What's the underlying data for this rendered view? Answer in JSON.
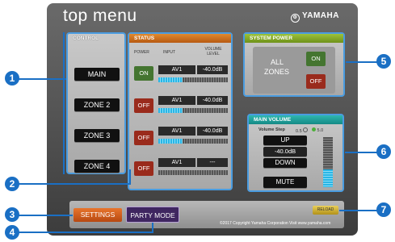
{
  "header": {
    "title": "top menu",
    "brand": "YAMAHA"
  },
  "control": {
    "heading": "CONTROL",
    "zones": [
      "MAIN",
      "ZONE 2",
      "ZONE 3",
      "ZONE 4"
    ]
  },
  "status": {
    "heading": "STATUS",
    "col_power": "POWER",
    "col_input": "INPUT",
    "col_volume": "VOLUME LEVEL",
    "rows": [
      {
        "power": "ON",
        "input": "AV1",
        "volume": "-40.0dB",
        "level": 0.35
      },
      {
        "power": "OFF",
        "input": "AV1",
        "volume": "-40.0dB",
        "level": 0.35
      },
      {
        "power": "OFF",
        "input": "AV1",
        "volume": "-40.0dB",
        "level": 0.35
      },
      {
        "power": "OFF",
        "input": "AV1",
        "volume": "---",
        "level": 0
      }
    ]
  },
  "system_power": {
    "heading": "SYSTEM POWER",
    "label_line1": "ALL",
    "label_line2": "ZONES",
    "on": "ON",
    "off": "OFF"
  },
  "main_volume": {
    "heading": "MAIN VOLUME",
    "step_label": "Volume Step",
    "step_opt1": "0.5",
    "step_opt2": "5.0",
    "up": "UP",
    "value": "-40.0dB",
    "down": "DOWN",
    "mute": "MUTE",
    "level": 0.35
  },
  "footer": {
    "settings": "SETTINGS",
    "party_mode": "PARTY MODE",
    "reload": "RELOAD",
    "copyright": "©2017 Copyright Yamaha Corporation Visit  www.yamaha.com"
  },
  "callouts": [
    "1",
    "2",
    "3",
    "4",
    "5",
    "6",
    "7"
  ],
  "colors": {
    "accent_blue": "#1a6fc4",
    "on_green": "#447530",
    "off_red": "#9a2b1c",
    "settings_orange": "#d4601e",
    "party_purple": "#3f2660"
  }
}
